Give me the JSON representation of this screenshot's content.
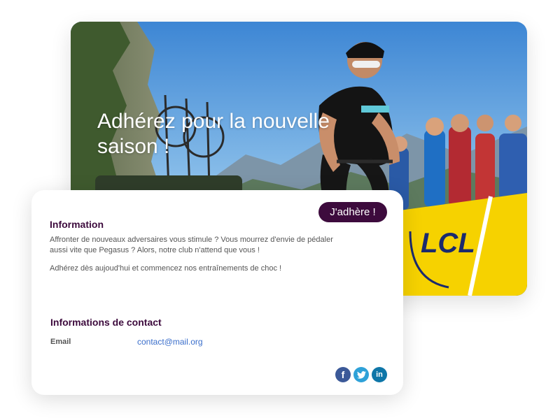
{
  "hero": {
    "title": "Adhérez pour la nouvelle saison !",
    "banner_text": "LCL"
  },
  "card": {
    "join_button": "J'adhère !",
    "information": {
      "title": "Information",
      "paragraph1": "Affronter de nouveaux adversaires vous stimule ? Vous mourrez d'envie de pédaler aussi vite que Pegasus ? Alors, notre club n'attend que vous !",
      "paragraph2": "Adhérez dès aujoud'hui et commencez nos entraînements de choc !"
    },
    "contact": {
      "title": "Informations de contact",
      "email_label": "Email",
      "email_value": "contact@mail.org"
    },
    "social": [
      {
        "name": "facebook-icon",
        "glyph": "f",
        "color": "#3b5998"
      },
      {
        "name": "twitter-icon",
        "glyph": "",
        "color": "#2ea1d8"
      },
      {
        "name": "linkedin-icon",
        "glyph": "in",
        "color": "#0e76a8"
      }
    ]
  },
  "colors": {
    "accent": "#3d0b3d",
    "link": "#3a6ecb",
    "banner_yellow": "#f6d200"
  }
}
